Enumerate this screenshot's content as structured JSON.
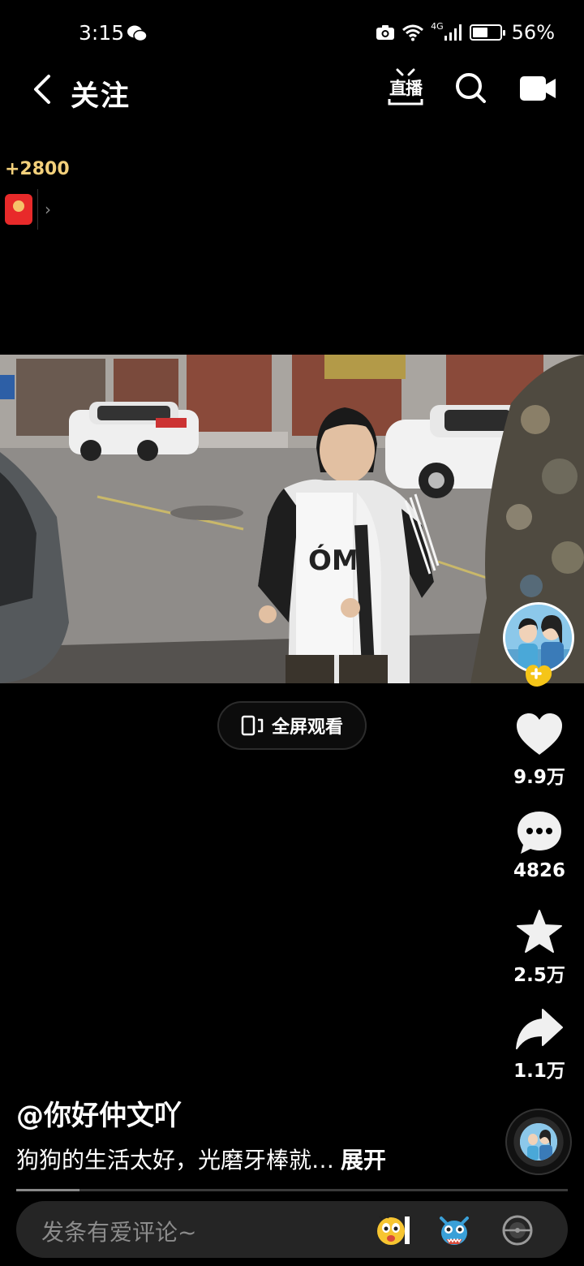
{
  "status_bar": {
    "time": "3:15",
    "network": "4G",
    "battery_percent": "56%",
    "battery_level": 0.56
  },
  "header": {
    "title": "关注",
    "live_label": "直播"
  },
  "reward": {
    "amount": "+2800"
  },
  "video": {
    "fullscreen_label": "全屏观看"
  },
  "actions": {
    "likes": "9.9万",
    "comments": "4826",
    "favorites": "2.5万",
    "shares": "1.1万"
  },
  "post": {
    "author": "@你好仲文吖",
    "caption": "狗狗的生活太好，光磨牙棒就…",
    "expand_label": "展开",
    "progress": 0.115
  },
  "comment_bar": {
    "placeholder": "发条有爱评论~"
  },
  "colors": {
    "background": "#000000",
    "reward_gold": "#f3d07b",
    "follow_badge": "#f5c518",
    "comment_bar": "#252525"
  }
}
